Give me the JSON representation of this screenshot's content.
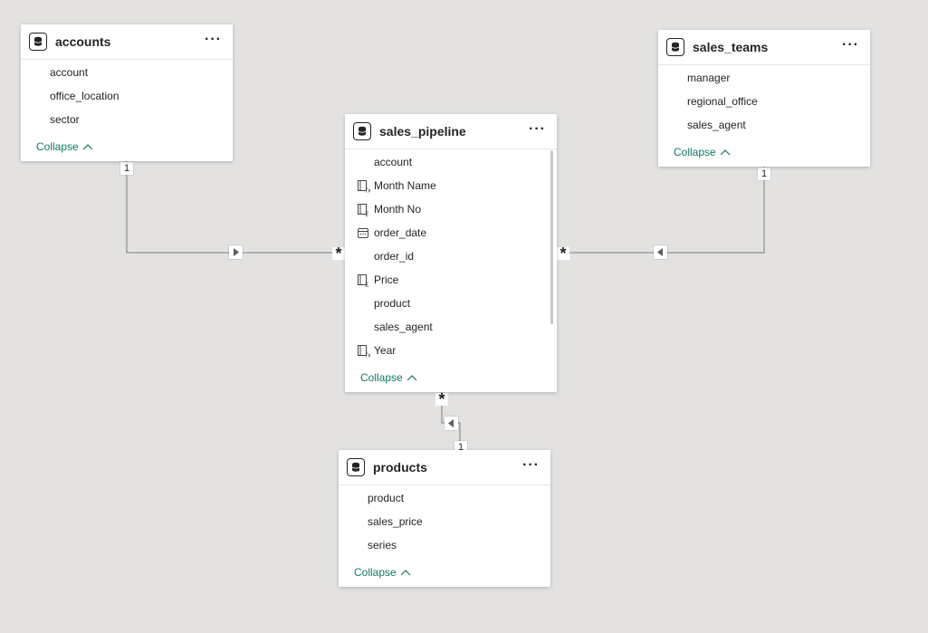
{
  "tables": {
    "accounts": {
      "title": "accounts",
      "more": "···",
      "collapse": "Collapse",
      "fields": [
        "account",
        "office_location",
        "sector"
      ]
    },
    "sales_teams": {
      "title": "sales_teams",
      "more": "···",
      "collapse": "Collapse",
      "fields": [
        "manager",
        "regional_office",
        "sales_agent"
      ]
    },
    "sales_pipeline": {
      "title": "sales_pipeline",
      "more": "···",
      "collapse": "Collapse",
      "fields": [
        {
          "name": "account",
          "icon": "none"
        },
        {
          "name": "Month Name",
          "icon": "calculated-column-icon"
        },
        {
          "name": "Month No",
          "icon": "measure-icon"
        },
        {
          "name": "order_date",
          "icon": "calendar-icon"
        },
        {
          "name": "order_id",
          "icon": "none"
        },
        {
          "name": "Price",
          "icon": "measure-icon"
        },
        {
          "name": "product",
          "icon": "none"
        },
        {
          "name": "sales_agent",
          "icon": "none"
        },
        {
          "name": "Year",
          "icon": "calculated-column-icon"
        }
      ]
    },
    "products": {
      "title": "products",
      "more": "···",
      "collapse": "Collapse",
      "fields": [
        "product",
        "sales_price",
        "series"
      ]
    }
  },
  "relationships": {
    "accounts_pipeline": {
      "one": "1",
      "many": "*"
    },
    "teams_pipeline": {
      "one": "1",
      "many": "*"
    },
    "products_pipeline": {
      "one": "1",
      "many": "*"
    }
  },
  "colors": {
    "canvas": "#e3e2e1",
    "collapse_link": "#117865",
    "line": "#9e9e9e"
  }
}
